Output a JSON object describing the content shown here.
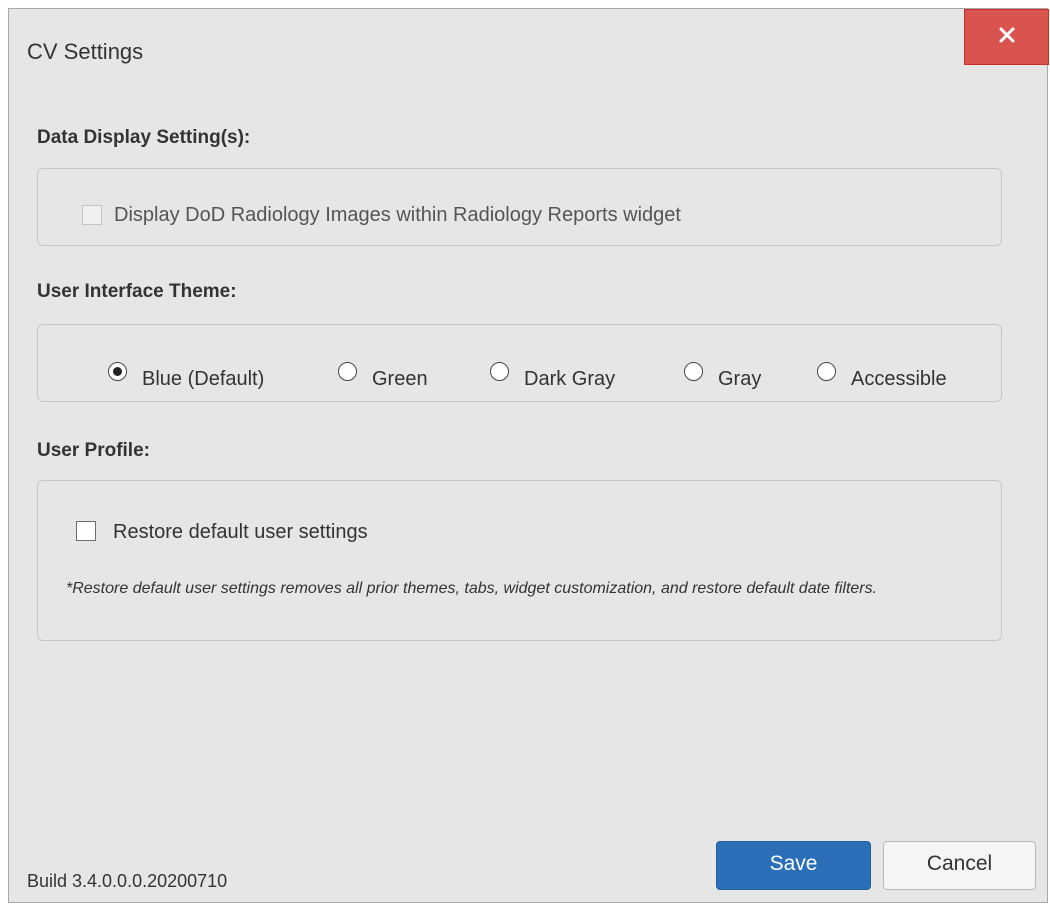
{
  "dialog": {
    "title": "CV Settings",
    "close_icon": "close-icon"
  },
  "data_display": {
    "heading": "Data Display Setting(s):",
    "option_label": "Display DoD Radiology Images within Radiology Reports widget",
    "checked": false,
    "disabled": true
  },
  "theme": {
    "heading": "User Interface Theme:",
    "selected": "Blue (Default)",
    "options": [
      {
        "label": "Blue (Default)",
        "checked": true
      },
      {
        "label": "Green",
        "checked": false
      },
      {
        "label": "Dark Gray",
        "checked": false
      },
      {
        "label": "Gray",
        "checked": false
      },
      {
        "label": "Accessible",
        "checked": false
      }
    ]
  },
  "user_profile": {
    "heading": "User Profile:",
    "option_label": "Restore default user settings",
    "checked": false,
    "note": "*Restore default user settings removes all prior themes, tabs, widget customization, and restore default date filters."
  },
  "footer": {
    "build": "Build 3.4.0.0.0.20200710",
    "save_label": "Save",
    "cancel_label": "Cancel"
  },
  "colors": {
    "close_button": "#d9534f",
    "save_button": "#2a6fb8",
    "dialog_background": "#e6e6e6"
  }
}
